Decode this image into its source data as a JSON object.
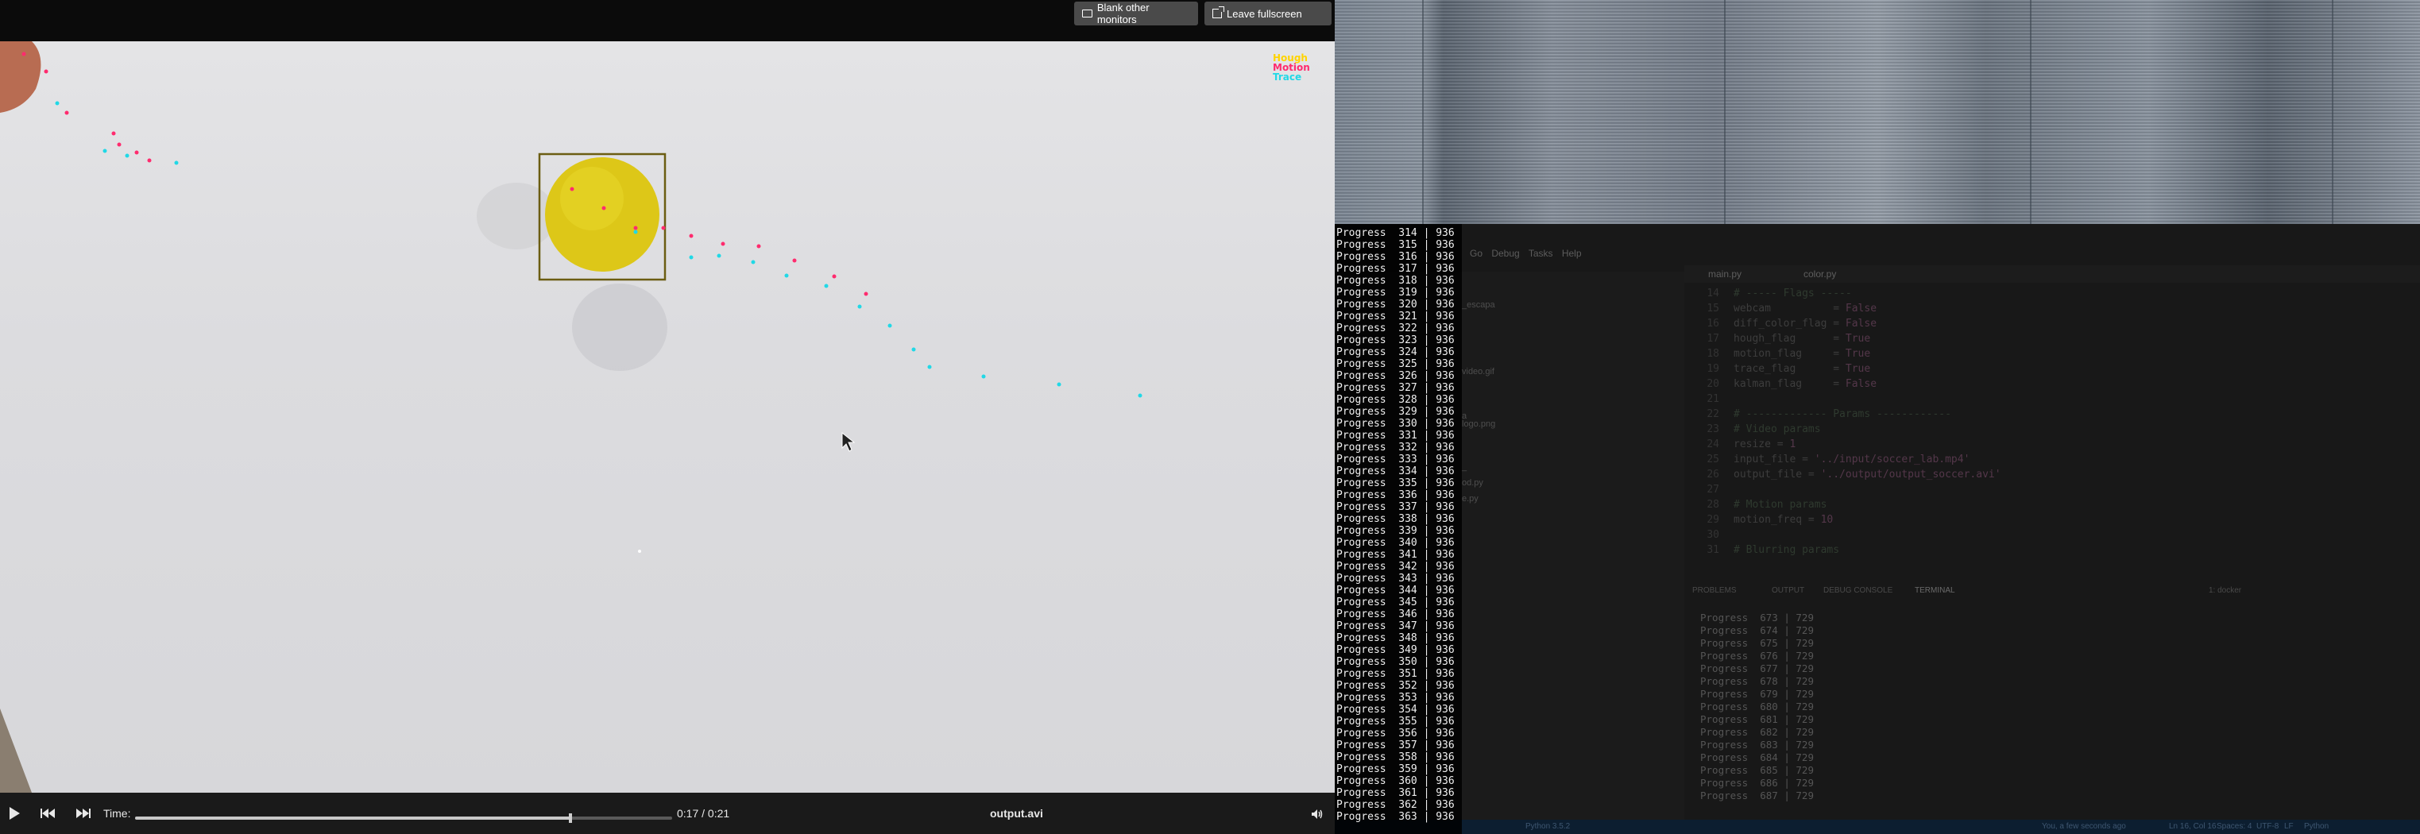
{
  "player": {
    "top_buttons": {
      "blank_monitors": "Blank other monitors",
      "leave_fullscreen": "Leave fullscreen"
    },
    "legend": {
      "hough": "Hough",
      "motion": "Motion",
      "trace": "Trace"
    },
    "legend_colors": {
      "hough": "#ffd400",
      "motion": "#ff2b6e",
      "trace": "#21d8e6"
    },
    "controls": {
      "time_label": "Time:",
      "time_value": "0:17 / 0:21",
      "filename": "output.avi",
      "progress": 0.81
    }
  },
  "console": {
    "total": "936",
    "rows": [
      "314",
      "315",
      "316",
      "317",
      "318",
      "319",
      "320",
      "321",
      "322",
      "323",
      "324",
      "325",
      "326",
      "327",
      "328",
      "329",
      "330",
      "331",
      "332",
      "333",
      "334",
      "335",
      "336",
      "337",
      "338",
      "339",
      "340",
      "341",
      "342",
      "343",
      "344",
      "345",
      "346",
      "347",
      "348",
      "349",
      "350",
      "351",
      "352",
      "353",
      "354",
      "355",
      "356",
      "357",
      "358",
      "359",
      "360",
      "361",
      "362",
      "363"
    ],
    "label": "Progress"
  },
  "ide": {
    "menu": "Go Debug Tasks Help",
    "tabs": {
      "active": "main.py",
      "other": "color.py"
    },
    "sidebar_items": [
      "_escapa",
      "video.gif",
      "a",
      "logo.png",
      "_",
      "od.py",
      "e.py"
    ],
    "code": [
      {
        "ln": "14",
        "text": "# ----- Flags -----"
      },
      {
        "ln": "15",
        "key": "webcam          ",
        "op": "= ",
        "val": "False"
      },
      {
        "ln": "16",
        "key": "diff_color_flag ",
        "op": "= ",
        "val": "False"
      },
      {
        "ln": "17",
        "key": "hough_flag      ",
        "op": "= ",
        "val": "True"
      },
      {
        "ln": "18",
        "key": "motion_flag     ",
        "op": "= ",
        "val": "True"
      },
      {
        "ln": "19",
        "key": "trace_flag      ",
        "op": "= ",
        "val": "True"
      },
      {
        "ln": "20",
        "key": "kalman_flag     ",
        "op": "= ",
        "val": "False"
      },
      {
        "ln": "21",
        "text": ""
      },
      {
        "ln": "22",
        "text": "# ------------- Params ------------"
      },
      {
        "ln": "23",
        "text": "# Video params"
      },
      {
        "ln": "24",
        "key": "resize ",
        "op": "= ",
        "val": "1"
      },
      {
        "ln": "25",
        "key": "input_file ",
        "op": "= ",
        "val": "'../input/soccer_lab.mp4'"
      },
      {
        "ln": "26",
        "key": "output_file ",
        "op": "= ",
        "val": "'../output/output_soccer.avi'"
      },
      {
        "ln": "27",
        "text": ""
      },
      {
        "ln": "28",
        "text": "# Motion params"
      },
      {
        "ln": "29",
        "key": "motion_freq ",
        "op": "= ",
        "val": "10"
      },
      {
        "ln": "30",
        "text": ""
      },
      {
        "ln": "31",
        "text": "# Blurring params"
      }
    ],
    "panel_tabs": [
      "PROBLEMS",
      "OUTPUT",
      "DEBUG CONSOLE",
      "TERMINAL"
    ],
    "terminal_select": "1: docker",
    "terminal_total": "729",
    "terminal_rows": [
      "673",
      "674",
      "675",
      "676",
      "677",
      "678",
      "679",
      "680",
      "681",
      "682",
      "683",
      "684",
      "685",
      "686",
      "687"
    ],
    "status": {
      "left": "Python 3.5.2",
      "msg": "You, a few seconds ago",
      "pos": "Ln 16, Col 16",
      "spaces": "Spaces: 4",
      "enc": "UTF-8",
      "eol": "LF",
      "lang": "Python"
    }
  }
}
